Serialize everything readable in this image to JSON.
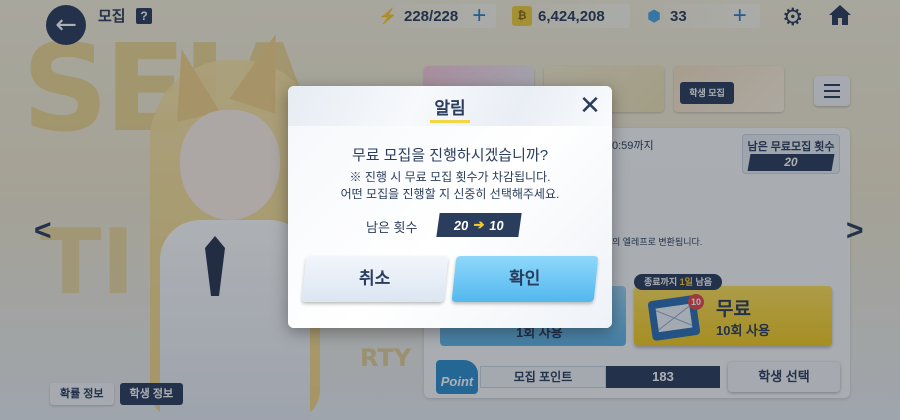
{
  "header": {
    "title": "모집",
    "help_symbol": "?",
    "stamina": "228/228",
    "credits": "6,424,208",
    "pyroxene": "33"
  },
  "background": {
    "remaining_free_label": "남은 무료모집 횟수",
    "remaining_free_value": "20",
    "time_text": "0:59까지",
    "desc_text": "의 엘레프로 변환됩니다.",
    "recruit_ticket_sub": "1회 사용",
    "free_badge_prefix": "종료까지",
    "free_badge_days": "1일",
    "free_badge_suffix": "남음",
    "free_title": "무료",
    "free_sub": "10회 사용",
    "free_count": "10",
    "point_logo": "Point",
    "point_label": "모집 포인트",
    "point_value": "183",
    "student_select": "학생 선택",
    "banner_tag": "학생 모집",
    "tab_rate_info": "확률 정보",
    "tab_student_info": "학생 정보",
    "bg_text_1": "SEIA",
    "bg_text_2": "TI",
    "bg_text_3": "RTY"
  },
  "dialog": {
    "title": "알림",
    "question": "무료 모집을 진행하시겠습니까?",
    "note_line1": "※ 진행 시 무료 모집 횟수가 차감됩니다.",
    "note_line2": "어떤 모집을 진행할 지 신중히 선택해주세요.",
    "remaining_label": "남은 횟수",
    "remaining_from": "20",
    "remaining_to": "10",
    "cancel_label": "취소",
    "confirm_label": "확인"
  },
  "colors": {
    "navy": "#2b3d5c",
    "accent_blue": "#52b8ee",
    "accent_yellow": "#f5c828"
  },
  "icons": [
    "back-arrow-icon",
    "stamina-bolt-icon",
    "credit-icon",
    "pyroxene-icon",
    "gear-icon",
    "home-icon",
    "close-icon",
    "arrow-right-icon",
    "menu-icon",
    "mail-icon"
  ]
}
